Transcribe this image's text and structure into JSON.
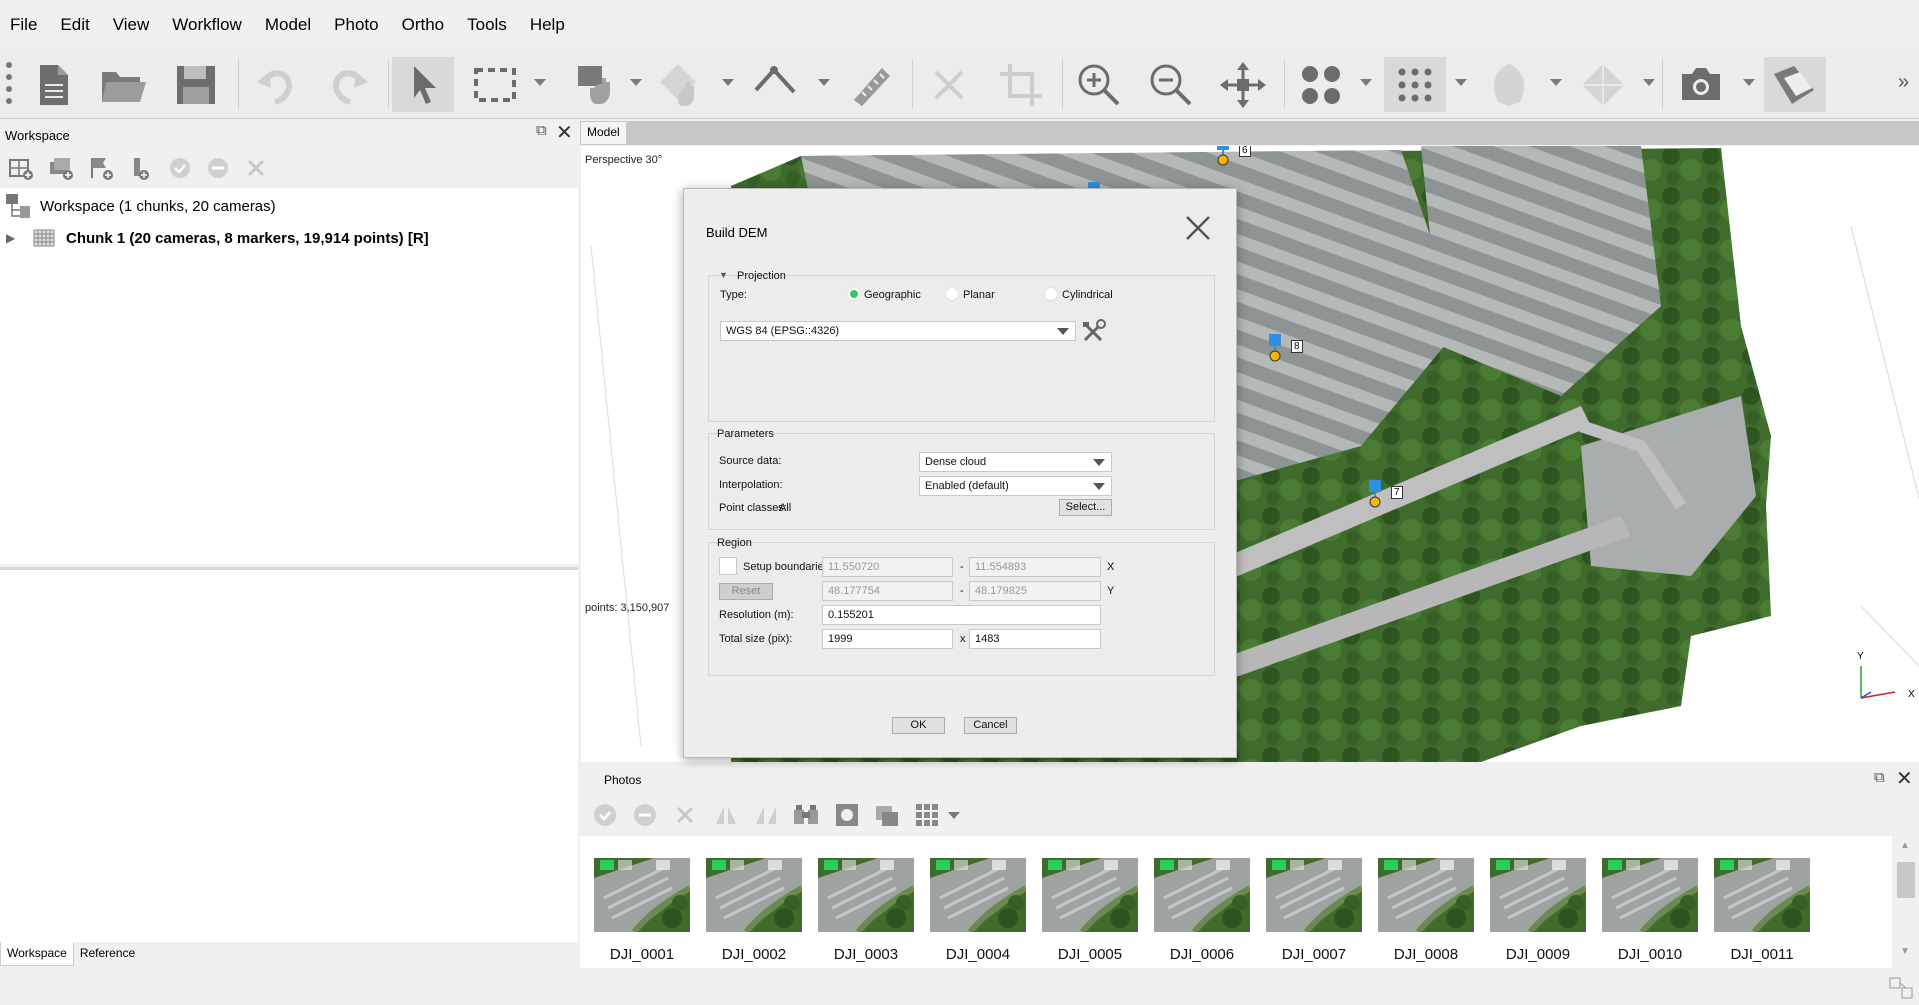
{
  "menu": [
    "File",
    "Edit",
    "View",
    "Workflow",
    "Model",
    "Photo",
    "Ortho",
    "Tools",
    "Help"
  ],
  "workspace": {
    "title": "Workspace",
    "root_label": "Workspace (1 chunks, 20 cameras)",
    "chunk_label": "Chunk 1 (20 cameras, 8 markers, 19,914 points) [R]",
    "tabs": [
      "Workspace",
      "Reference"
    ]
  },
  "model": {
    "tab": "Model",
    "perspective": "Perspective 30°",
    "points": "points: 3,150,907",
    "markers": [
      "4",
      "6",
      "8",
      "7"
    ],
    "axis_y": "Y",
    "axis_x": "X"
  },
  "dialog": {
    "title": "Build DEM",
    "projection": {
      "header": "Projection",
      "type_label": "Type:",
      "options": [
        "Geographic",
        "Planar",
        "Cylindrical"
      ],
      "selected": "Geographic",
      "crs": "WGS 84 (EPSG::4326)"
    },
    "parameters": {
      "header": "Parameters",
      "source_label": "Source data:",
      "source_value": "Dense cloud",
      "interp_label": "Interpolation:",
      "interp_value": "Enabled (default)",
      "classes_label": "Point classes:",
      "classes_value": "All",
      "select_btn": "Select..."
    },
    "region": {
      "header": "Region",
      "setup_label": "Setup boundaries:",
      "x_min": "11.550720",
      "x_max": "11.554893",
      "x_axis": "X",
      "reset_btn": "Reset",
      "y_min": "48.177754",
      "y_max": "48.179825",
      "y_axis": "Y",
      "dash": "-",
      "res_label": "Resolution (m):",
      "res_value": "0.155201",
      "size_label": "Total size (pix):",
      "size_w": "1999",
      "size_x": "x",
      "size_h": "1483"
    },
    "ok": "OK",
    "cancel": "Cancel"
  },
  "photos": {
    "title": "Photos",
    "items": [
      "DJI_0001",
      "DJI_0002",
      "DJI_0003",
      "DJI_0004",
      "DJI_0005",
      "DJI_0006",
      "DJI_0007",
      "DJI_0008",
      "DJI_0009",
      "DJI_0010",
      "DJI_0011"
    ]
  },
  "colors": {
    "accent_green": "#2ecc5c",
    "marker_blue": "#2f8fe0",
    "marker_yellow": "#f5b800"
  }
}
